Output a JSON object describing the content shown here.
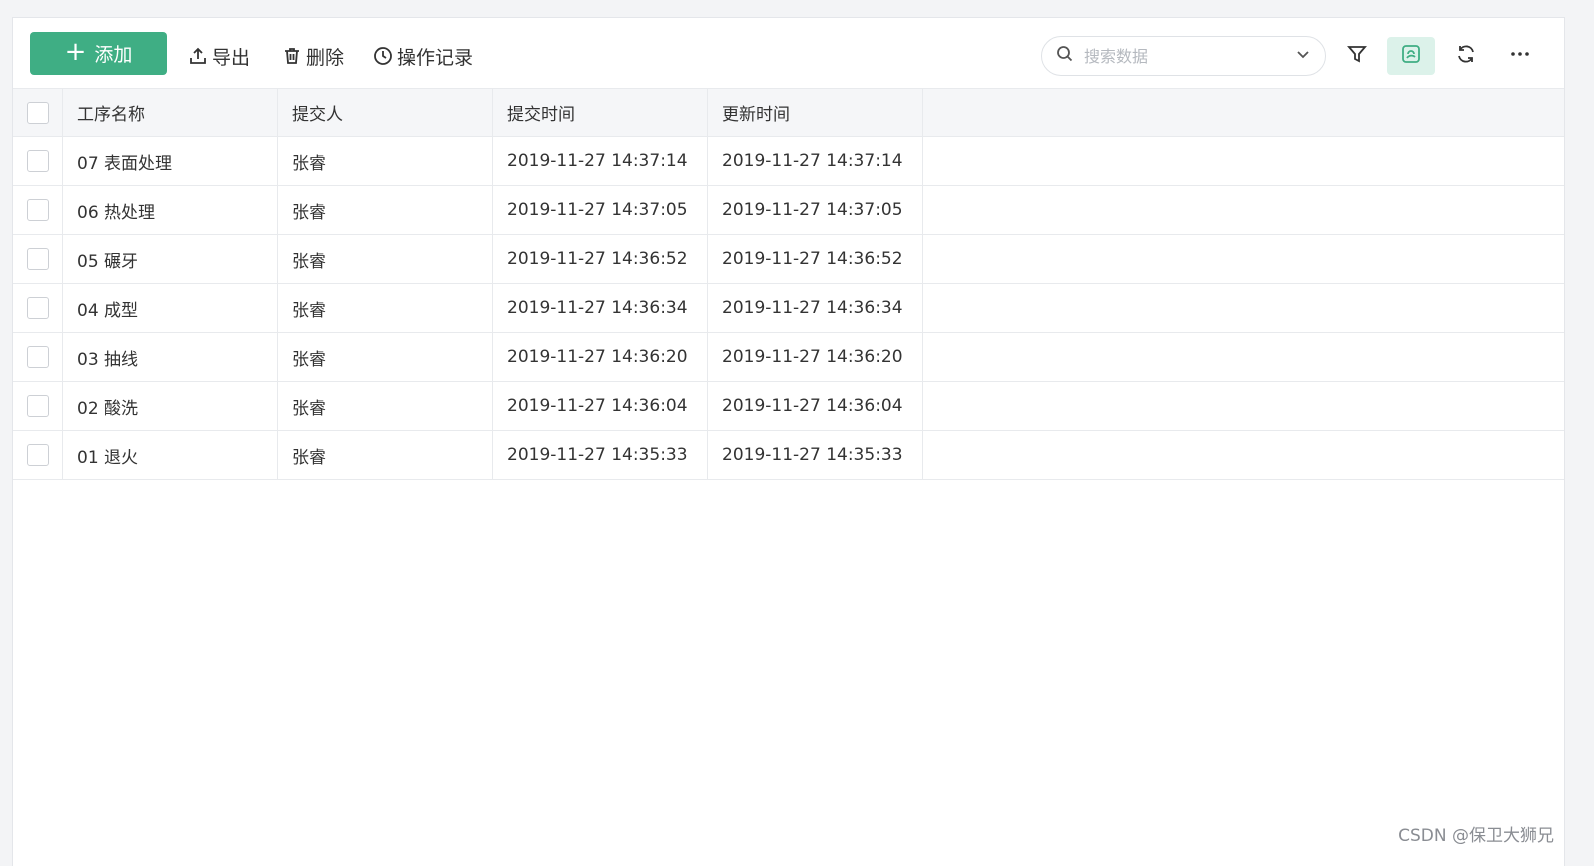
{
  "toolbar": {
    "add_label": "添加",
    "export_label": "导出",
    "delete_label": "删除",
    "history_label": "操作记录",
    "search_placeholder": "搜索数据"
  },
  "colors": {
    "accent": "#3fae84",
    "active_icon_bg": "#dcf2ea"
  },
  "icons": {
    "add": "plus-icon",
    "export": "upload-icon",
    "delete": "trash-icon",
    "history": "clock-icon",
    "search": "search-icon",
    "dropdown": "chevron-down-icon",
    "filter": "filter-icon",
    "view": "view-toggle-icon",
    "refresh": "refresh-icon",
    "more": "more-icon"
  },
  "table": {
    "columns": [
      "工序名称",
      "提交人",
      "提交时间",
      "更新时间"
    ],
    "rows": [
      [
        "07 表面处理",
        "张睿",
        "2019-11-27 14:37:14",
        "2019-11-27 14:37:14"
      ],
      [
        "06 热处理",
        "张睿",
        "2019-11-27 14:37:05",
        "2019-11-27 14:37:05"
      ],
      [
        "05 碾牙",
        "张睿",
        "2019-11-27 14:36:52",
        "2019-11-27 14:36:52"
      ],
      [
        "04 成型",
        "张睿",
        "2019-11-27 14:36:34",
        "2019-11-27 14:36:34"
      ],
      [
        "03 抽线",
        "张睿",
        "2019-11-27 14:36:20",
        "2019-11-27 14:36:20"
      ],
      [
        "02 酸洗",
        "张睿",
        "2019-11-27 14:36:04",
        "2019-11-27 14:36:04"
      ],
      [
        "01 退火",
        "张睿",
        "2019-11-27 14:35:33",
        "2019-11-27 14:35:33"
      ]
    ]
  },
  "watermark": "CSDN @保卫大狮兄"
}
